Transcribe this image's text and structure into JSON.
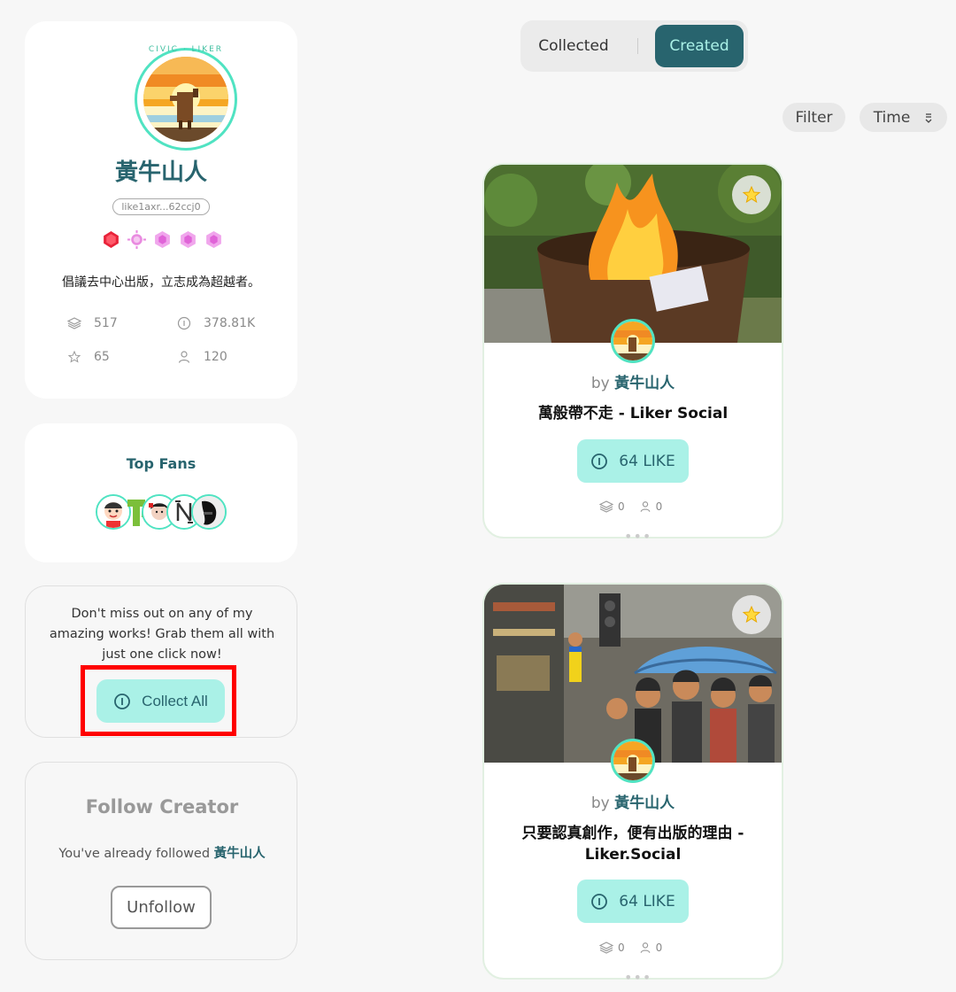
{
  "profile": {
    "avatar_badge_text": "CIVIC · LIKER",
    "display_name": "黃牛山人",
    "wallet": "like1axr...62ccj0",
    "bio": "倡議去中心出版，立志成為超越者。",
    "stats": {
      "collections": "517",
      "likes": "378.81K",
      "stars": "65",
      "followers": "120"
    }
  },
  "top_fans": {
    "title": "Top Fans"
  },
  "collect_all": {
    "text": "Don't miss out on any of my amazing works! Grab them all with just one click now!",
    "button_label": "Collect All"
  },
  "follow": {
    "title": "Follow Creator",
    "text_prefix": "You've already followed",
    "creator_name": "黃牛山人",
    "button_label": "Unfollow"
  },
  "tabs": {
    "collected": "Collected",
    "created": "Created"
  },
  "toolbar": {
    "filter": "Filter",
    "time": "Time"
  },
  "nfts": [
    {
      "by_prefix": "by",
      "author": "黃牛山人",
      "title": "萬般帶不走 - Liker Social",
      "like_label": "64 LIKE",
      "collects": "0",
      "owners": "0"
    },
    {
      "by_prefix": "by",
      "author": "黃牛山人",
      "title": "只要認真創作，便有出版的理由 - Liker.Social",
      "like_label": "64 LIKE",
      "collects": "0",
      "owners": "0"
    }
  ],
  "colors": {
    "primary": "#28646e",
    "accent": "#aaf1e7",
    "ring": "#50e3c2",
    "highlight_box": "#ff0000"
  }
}
